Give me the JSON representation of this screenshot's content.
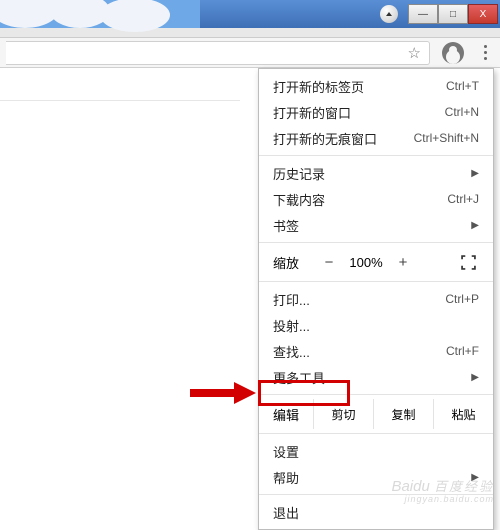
{
  "window_controls": {
    "min": "—",
    "max": "□",
    "close": "X"
  },
  "menu": {
    "new_tab": {
      "label": "打开新的标签页",
      "shortcut": "Ctrl+T"
    },
    "new_window": {
      "label": "打开新的窗口",
      "shortcut": "Ctrl+N"
    },
    "incognito": {
      "label": "打开新的无痕窗口",
      "shortcut": "Ctrl+Shift+N"
    },
    "history": {
      "label": "历史记录"
    },
    "downloads": {
      "label": "下载内容",
      "shortcut": "Ctrl+J"
    },
    "bookmarks": {
      "label": "书签"
    },
    "zoom": {
      "label": "缩放",
      "value": "100%",
      "minus": "−",
      "plus": "+"
    },
    "print": {
      "label": "打印...",
      "shortcut": "Ctrl+P"
    },
    "cast": {
      "label": "投射..."
    },
    "find": {
      "label": "查找...",
      "shortcut": "Ctrl+F"
    },
    "more_tools": {
      "label": "更多工具"
    },
    "edit": {
      "label": "编辑",
      "cut": "剪切",
      "copy": "复制",
      "paste": "粘贴"
    },
    "settings": {
      "label": "设置"
    },
    "help": {
      "label": "帮助"
    },
    "exit": {
      "label": "退出"
    }
  },
  "watermark": {
    "cn": "百度经验",
    "py": "jingyan.baidu.com"
  }
}
